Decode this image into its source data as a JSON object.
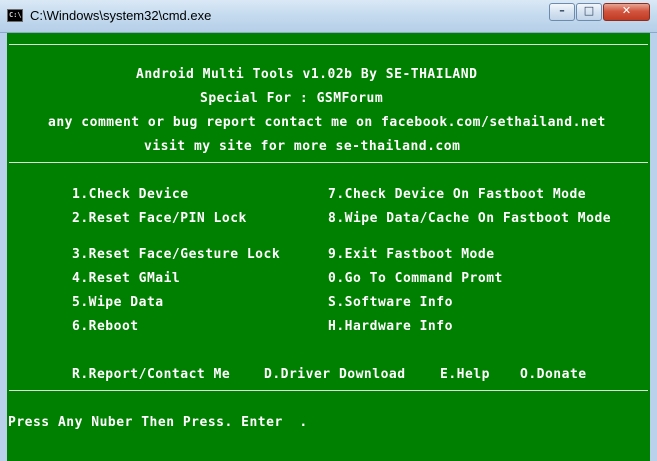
{
  "window": {
    "title": "C:\\Windows\\system32\\cmd.exe",
    "icon_text": "C:\\",
    "minimize_glyph": "–",
    "maximize_glyph": "□",
    "close_glyph": "✕"
  },
  "console": {
    "background": "#008000",
    "text_color": "#ffffff",
    "banner": {
      "title": "Android Multi Tools v1.02b By SE-THAILAND",
      "special": "Special For : GSMForum",
      "contact": "any comment or bug report contact me on facebook.com/sethailand.net",
      "site": "visit my site for more se-thailand.com"
    },
    "menu_left": [
      "1.Check Device",
      "2.Reset Face/PIN Lock",
      "3.Reset Face/Gesture Lock",
      "4.Reset GMail",
      "5.Wipe Data",
      "6.Reboot"
    ],
    "menu_right": [
      "7.Check Device On Fastboot Mode",
      "8.Wipe Data/Cache On Fastboot Mode",
      "9.Exit Fastboot Mode",
      "0.Go To Command Promt",
      "S.Software Info",
      "H.Hardware Info"
    ],
    "menu_bottom": [
      "R.Report/Contact Me",
      "D.Driver Download",
      "E.Help",
      "O.Donate"
    ],
    "prompt": "Press Any Nuber Then Press. Enter  ."
  }
}
